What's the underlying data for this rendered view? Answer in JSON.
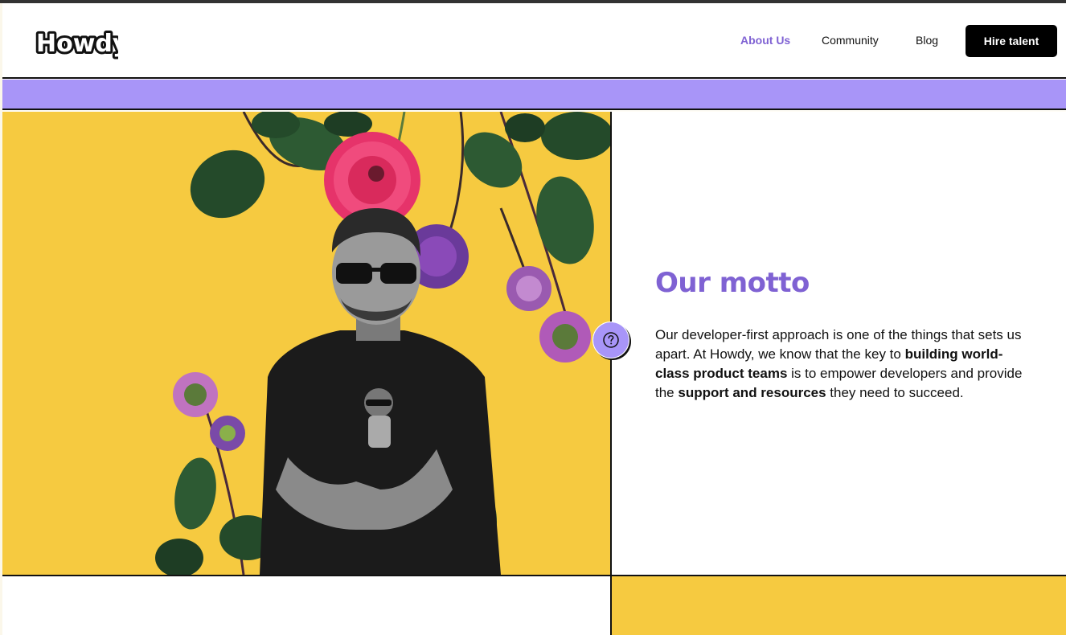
{
  "header": {
    "logo_text": "Howdy",
    "nav": {
      "about": "About Us",
      "community": "Community",
      "blog": "Blog"
    },
    "cta_label": "Hire talent"
  },
  "hero": {
    "image_icon": "person-with-flowers-photo"
  },
  "motto": {
    "title": "Our motto",
    "p1": "Our developer-first approach is one of the things that sets us apart. At Howdy, we know that the key to ",
    "b1": "building world-class product teams",
    "p2": " is to empower developers and provide the ",
    "b2": "support and resources",
    "p3": " they need to succeed."
  },
  "help": {
    "icon": "question-circle-icon"
  },
  "colors": {
    "accent_purple": "#7f62d3",
    "band_purple": "#a895f8",
    "yellow": "#f6ca40",
    "black": "#000000"
  }
}
